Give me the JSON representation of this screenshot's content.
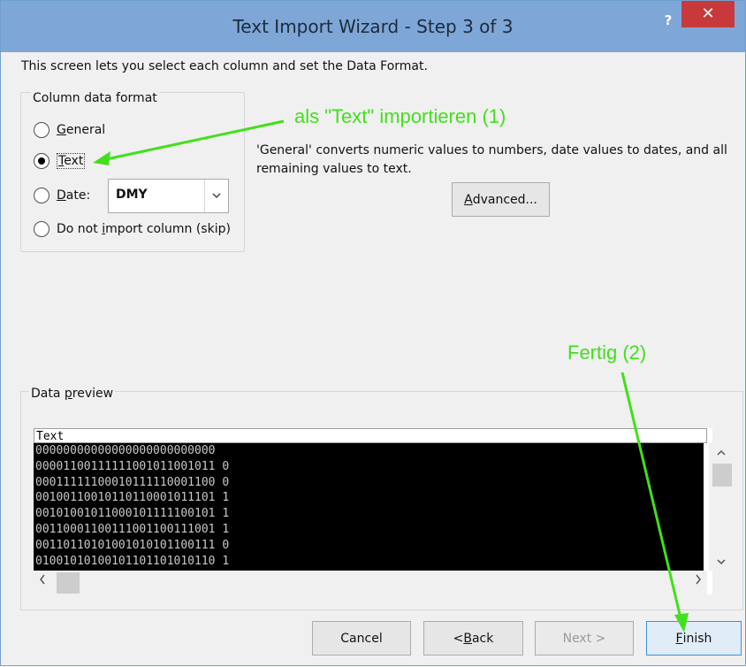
{
  "window": {
    "title": "Text Import Wizard - Step 3 of 3",
    "help_label": "?",
    "close_label": "✕"
  },
  "intro_text": "This screen lets you select each column and set the Data Format.",
  "column_format": {
    "legend": "Column data format",
    "general_label": "General",
    "text_label": "Text",
    "date_label": "Date:",
    "skip_label": "Do not import column (skip)",
    "selected": "Text",
    "date_value": "DMY"
  },
  "description": "'General' converts numeric values to numbers, date values to dates, and all remaining values to text.",
  "advanced_label": "Advanced...",
  "preview": {
    "legend": "Data preview",
    "header": "Text",
    "rows": [
      "00000000000000000000000000",
      "00001100111111001011001011 0",
      "00011111100010111110001100 0",
      "00100110010110110001011101 1",
      "00101001011000101111100101 1",
      "00110001100111001100111001 1",
      "00110110101001010101100111 0",
      "01001010100101101101010110 1"
    ]
  },
  "buttons": {
    "cancel": "Cancel",
    "back": "< Back",
    "next": "Next >",
    "finish": "Finish"
  },
  "annotations": {
    "text_note": "als \"Text\" importieren (1)",
    "finish_note": "Fertig (2)",
    "color": "#41e01b"
  }
}
